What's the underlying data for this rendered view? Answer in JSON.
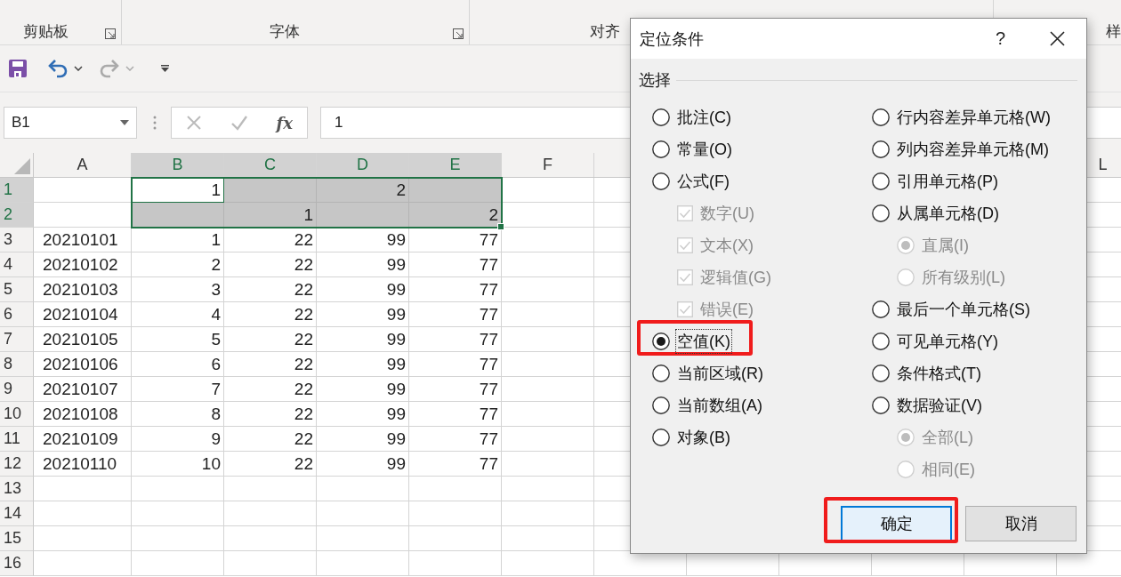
{
  "ribbon": {
    "groups": [
      {
        "label": "剪贴板",
        "launcher": true
      },
      {
        "label": "字体",
        "launcher": true
      },
      {
        "label": "对齐",
        "launcher": false
      },
      {
        "label": "样",
        "launcher": false
      }
    ]
  },
  "name_box": "B1",
  "formula": "1",
  "fx": "fx",
  "sheet": {
    "columns": [
      {
        "label": "A",
        "selected": false
      },
      {
        "label": "B",
        "selected": true
      },
      {
        "label": "C",
        "selected": true
      },
      {
        "label": "D",
        "selected": true
      },
      {
        "label": "E",
        "selected": true
      },
      {
        "label": "F",
        "selected": false
      }
    ],
    "last_column": {
      "label": "L"
    },
    "rows": [
      {
        "header": "1",
        "selected": true,
        "cells": [
          null,
          {
            "text": "1",
            "active": true
          },
          null,
          {
            "text": "2",
            "active": false
          },
          null
        ]
      },
      {
        "header": "2",
        "selected": true,
        "cells": [
          null,
          null,
          {
            "text": "1",
            "active": false
          },
          null,
          {
            "text": "2",
            "active": false
          }
        ]
      },
      {
        "header": "3",
        "selected": false,
        "cells": [
          {
            "text": "20210101",
            "active": false
          },
          {
            "text": "1",
            "active": false
          },
          {
            "text": "22",
            "active": false
          },
          {
            "text": "99",
            "active": false
          },
          {
            "text": "77",
            "active": false
          }
        ]
      },
      {
        "header": "4",
        "selected": false,
        "cells": [
          {
            "text": "20210102",
            "active": false
          },
          {
            "text": "2",
            "active": false
          },
          {
            "text": "22",
            "active": false
          },
          {
            "text": "99",
            "active": false
          },
          {
            "text": "77",
            "active": false
          }
        ]
      },
      {
        "header": "5",
        "selected": false,
        "cells": [
          {
            "text": "20210103",
            "active": false
          },
          {
            "text": "3",
            "active": false
          },
          {
            "text": "22",
            "active": false
          },
          {
            "text": "99",
            "active": false
          },
          {
            "text": "77",
            "active": false
          }
        ]
      },
      {
        "header": "6",
        "selected": false,
        "cells": [
          {
            "text": "20210104",
            "active": false
          },
          {
            "text": "4",
            "active": false
          },
          {
            "text": "22",
            "active": false
          },
          {
            "text": "99",
            "active": false
          },
          {
            "text": "77",
            "active": false
          }
        ]
      },
      {
        "header": "7",
        "selected": false,
        "cells": [
          {
            "text": "20210105",
            "active": false
          },
          {
            "text": "5",
            "active": false
          },
          {
            "text": "22",
            "active": false
          },
          {
            "text": "99",
            "active": false
          },
          {
            "text": "77",
            "active": false
          }
        ]
      },
      {
        "header": "8",
        "selected": false,
        "cells": [
          {
            "text": "20210106",
            "active": false
          },
          {
            "text": "6",
            "active": false
          },
          {
            "text": "22",
            "active": false
          },
          {
            "text": "99",
            "active": false
          },
          {
            "text": "77",
            "active": false
          }
        ]
      },
      {
        "header": "9",
        "selected": false,
        "cells": [
          {
            "text": "20210107",
            "active": false
          },
          {
            "text": "7",
            "active": false
          },
          {
            "text": "22",
            "active": false
          },
          {
            "text": "99",
            "active": false
          },
          {
            "text": "77",
            "active": false
          }
        ]
      },
      {
        "header": "10",
        "selected": false,
        "cells": [
          {
            "text": "20210108",
            "active": false
          },
          {
            "text": "8",
            "active": false
          },
          {
            "text": "22",
            "active": false
          },
          {
            "text": "99",
            "active": false
          },
          {
            "text": "77",
            "active": false
          }
        ]
      },
      {
        "header": "11",
        "selected": false,
        "cells": [
          {
            "text": "20210109",
            "active": false
          },
          {
            "text": "9",
            "active": false
          },
          {
            "text": "22",
            "active": false
          },
          {
            "text": "99",
            "active": false
          },
          {
            "text": "77",
            "active": false
          }
        ]
      },
      {
        "header": "12",
        "selected": false,
        "cells": [
          {
            "text": "20210110",
            "active": false
          },
          {
            "text": "10",
            "active": false
          },
          {
            "text": "22",
            "active": false
          },
          {
            "text": "99",
            "active": false
          },
          {
            "text": "77",
            "active": false
          }
        ]
      },
      {
        "header": "13",
        "selected": false,
        "cells": []
      },
      {
        "header": "14",
        "selected": false,
        "cells": []
      },
      {
        "header": "15",
        "selected": false,
        "cells": []
      },
      {
        "header": "16",
        "selected": false,
        "cells": []
      }
    ]
  },
  "dialog": {
    "title": "定位条件",
    "help": "?",
    "group_label": "选择",
    "columns": [
      [
        {
          "kind": "radio",
          "label": "批注(C)",
          "selected": false,
          "disabled": false,
          "focused": false,
          "highlighted": false
        },
        {
          "kind": "radio",
          "label": "常量(O)",
          "selected": false,
          "disabled": false,
          "focused": false,
          "highlighted": false
        },
        {
          "kind": "radio",
          "label": "公式(F)",
          "selected": false,
          "disabled": false,
          "focused": false,
          "highlighted": false,
          "children": [
            {
              "kind": "checkbox",
              "label": "数字(U)",
              "checked": true,
              "disabled": true,
              "focused": false,
              "highlighted": false
            },
            {
              "kind": "checkbox",
              "label": "文本(X)",
              "checked": true,
              "disabled": true,
              "focused": false,
              "highlighted": false
            },
            {
              "kind": "checkbox",
              "label": "逻辑值(G)",
              "checked": true,
              "disabled": true,
              "focused": false,
              "highlighted": false
            },
            {
              "kind": "checkbox",
              "label": "错误(E)",
              "checked": true,
              "disabled": true,
              "focused": false,
              "highlighted": false
            }
          ]
        },
        {
          "kind": "radio",
          "label": "空值(K)",
          "selected": true,
          "disabled": false,
          "focused": true,
          "highlighted": true
        },
        {
          "kind": "radio",
          "label": "当前区域(R)",
          "selected": false,
          "disabled": false,
          "focused": false,
          "highlighted": false
        },
        {
          "kind": "radio",
          "label": "当前数组(A)",
          "selected": false,
          "disabled": false,
          "focused": false,
          "highlighted": false
        },
        {
          "kind": "radio",
          "label": "对象(B)",
          "selected": false,
          "disabled": false,
          "focused": false,
          "highlighted": false
        }
      ],
      [
        {
          "kind": "radio",
          "label": "行内容差异单元格(W)",
          "selected": false,
          "disabled": false,
          "focused": false,
          "highlighted": false
        },
        {
          "kind": "radio",
          "label": "列内容差异单元格(M)",
          "selected": false,
          "disabled": false,
          "focused": false,
          "highlighted": false
        },
        {
          "kind": "radio",
          "label": "引用单元格(P)",
          "selected": false,
          "disabled": false,
          "focused": false,
          "highlighted": false
        },
        {
          "kind": "radio",
          "label": "从属单元格(D)",
          "selected": false,
          "disabled": false,
          "focused": false,
          "highlighted": false,
          "children": [
            {
              "kind": "radio",
              "label": "直属(I)",
              "selected": true,
              "disabled": true,
              "focused": false,
              "highlighted": false
            },
            {
              "kind": "radio",
              "label": "所有级别(L)",
              "selected": false,
              "disabled": true,
              "focused": false,
              "highlighted": false
            }
          ]
        },
        {
          "kind": "radio",
          "label": "最后一个单元格(S)",
          "selected": false,
          "disabled": false,
          "focused": false,
          "highlighted": false
        },
        {
          "kind": "radio",
          "label": "可见单元格(Y)",
          "selected": false,
          "disabled": false,
          "focused": false,
          "highlighted": false
        },
        {
          "kind": "radio",
          "label": "条件格式(T)",
          "selected": false,
          "disabled": false,
          "focused": false,
          "highlighted": false
        },
        {
          "kind": "radio",
          "label": "数据验证(V)",
          "selected": false,
          "disabled": false,
          "focused": false,
          "highlighted": false,
          "children": [
            {
              "kind": "radio",
              "label": "全部(L)",
              "selected": true,
              "disabled": true,
              "focused": false,
              "highlighted": false
            },
            {
              "kind": "radio",
              "label": "相同(E)",
              "selected": false,
              "disabled": true,
              "focused": false,
              "highlighted": false
            }
          ]
        }
      ]
    ],
    "buttons": [
      {
        "label": "确定",
        "kind": "primary",
        "highlighted": true
      },
      {
        "label": "取消",
        "kind": "secondary",
        "highlighted": false
      }
    ]
  }
}
